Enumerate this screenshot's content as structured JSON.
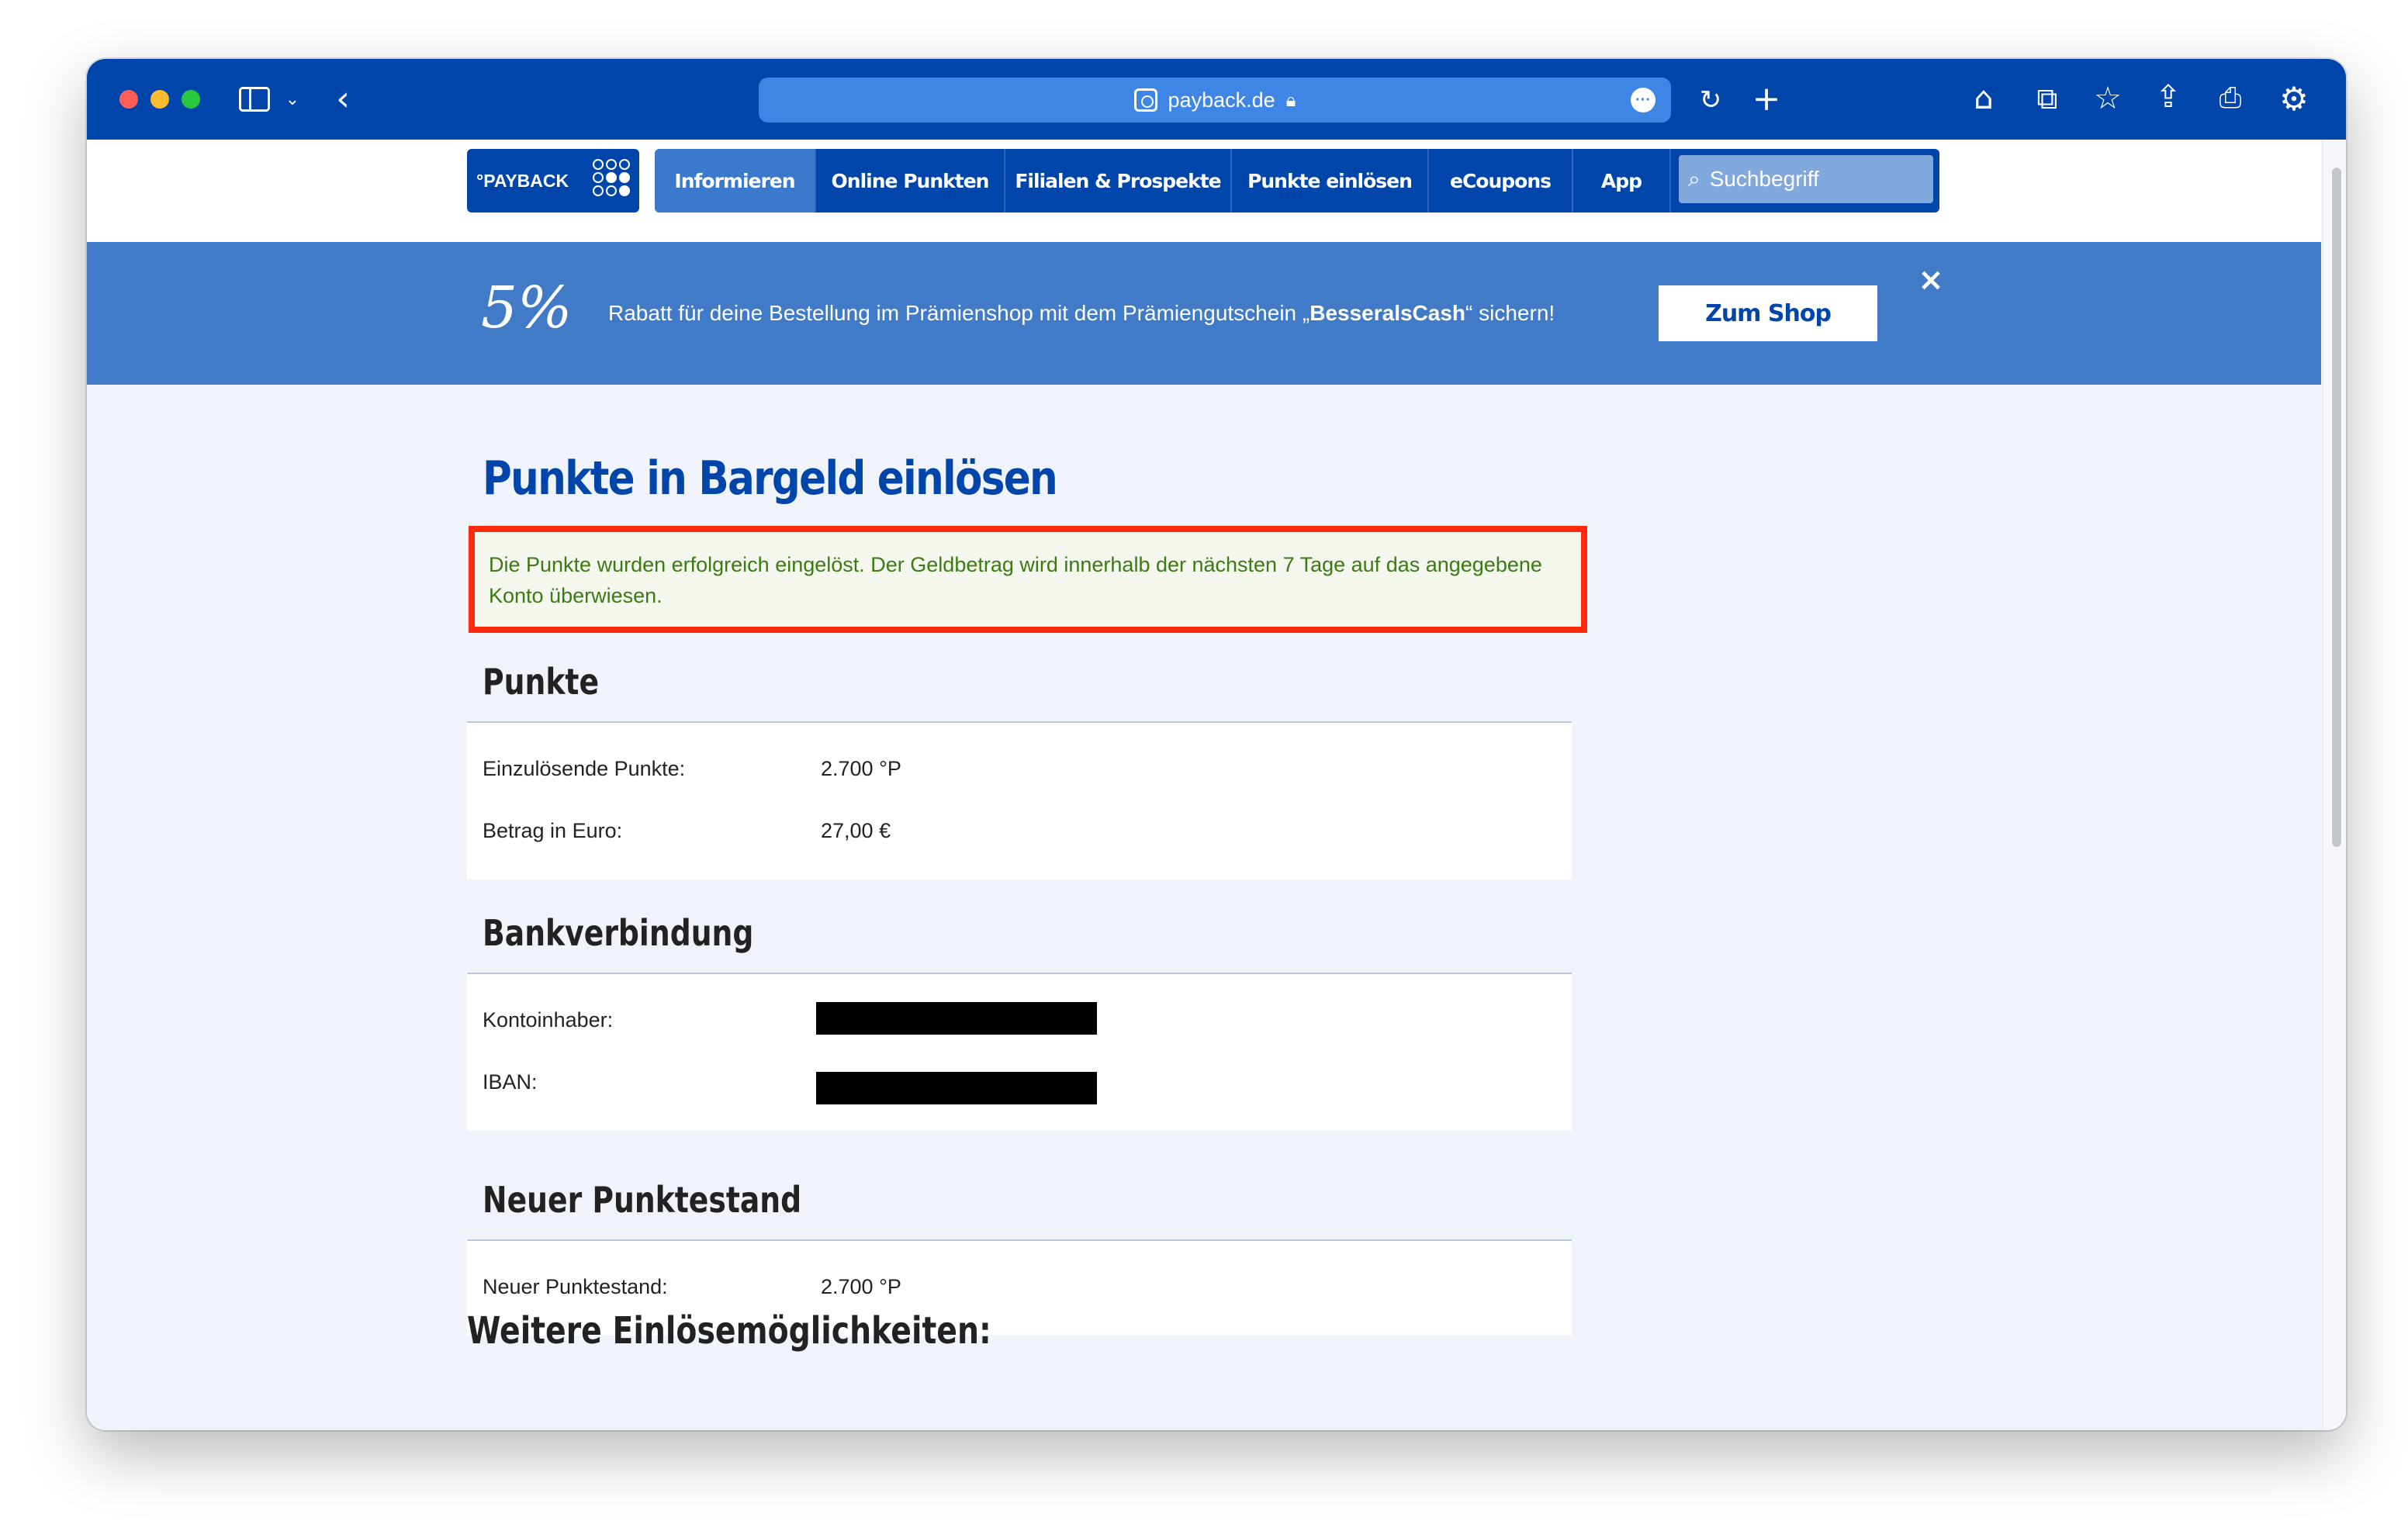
{
  "browser": {
    "url": "payback.de",
    "icons": [
      "sidebar-icon",
      "chevron-down-icon",
      "back-icon",
      "site-icon",
      "lock-icon",
      "more-icon",
      "reload-icon",
      "plus-icon",
      "home-icon",
      "tabs-icon",
      "star-icon",
      "share-icon",
      "print-icon",
      "gear-icon"
    ]
  },
  "header": {
    "logo": "°PAYBACK",
    "nav": [
      {
        "label": "Informieren",
        "active": true
      },
      {
        "label": "Online Punkten"
      },
      {
        "label": "Filialen & Prospekte"
      },
      {
        "label": "Punkte einlösen"
      },
      {
        "label": "eCoupons"
      },
      {
        "label": "App"
      }
    ],
    "search_placeholder": "Suchbegriff"
  },
  "promo": {
    "percent": "5%",
    "text_before": "Rabatt für deine Bestellung im Prämienshop mit dem Prämiengutschein „",
    "code": "BesseralsCash",
    "text_after": "“ sichern!",
    "button": "Zum Shop",
    "close": "×"
  },
  "main": {
    "title": "Punkte in Bargeld einlösen",
    "success_message": "Die Punkte wurden erfolgreich eingelöst. Der Geldbetrag wird innerhalb der nächsten 7 Tage auf das angegebene Konto überwiesen.",
    "points_section": {
      "title": "Punkte",
      "rows": [
        {
          "label": "Einzulösende Punkte:",
          "value": "2.700 °P"
        },
        {
          "label": "Betrag in Euro:",
          "value": "27,00 €"
        }
      ]
    },
    "bank_section": {
      "title": "Bankverbindung",
      "rows": [
        {
          "label": "Kontoinhaber:"
        },
        {
          "label": "IBAN:"
        }
      ]
    },
    "new_balance_section": {
      "title": "Neuer Punktestand",
      "rows": [
        {
          "label": "Neuer Punktestand:",
          "value": "2.700 °P"
        }
      ]
    },
    "more_title": "Weitere Einlösemöglichkeiten:"
  },
  "colors": {
    "brand": "#0046aa",
    "promo_bg": "#417ac6",
    "highlight_border": "#ff2a0e",
    "success_text": "#3c7a12"
  }
}
